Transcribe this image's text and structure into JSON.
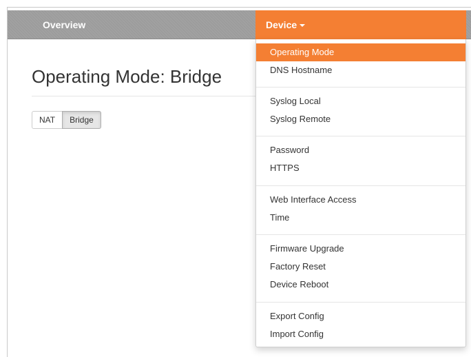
{
  "navbar": {
    "overview_label": "Overview",
    "device_label": "Device",
    "accent_color": "#f47f33"
  },
  "main": {
    "title": "Operating Mode: Bridge",
    "mode_buttons": [
      "NAT",
      "Bridge"
    ],
    "selected_mode": "Bridge"
  },
  "dropdown": {
    "groups": [
      [
        "Operating Mode",
        "DNS Hostname"
      ],
      [
        "Syslog Local",
        "Syslog Remote"
      ],
      [
        "Password",
        "HTTPS"
      ],
      [
        "Web Interface Access",
        "Time"
      ],
      [
        "Firmware Upgrade",
        "Factory Reset",
        "Device Reboot"
      ],
      [
        "Export Config",
        "Import Config"
      ]
    ],
    "active_item": "Operating Mode"
  }
}
